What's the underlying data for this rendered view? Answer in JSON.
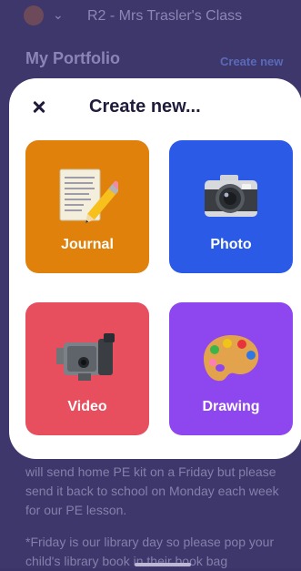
{
  "background": {
    "class_name": "R2 - Mrs Trasler's Class",
    "portfolio_title": "My Portfolio",
    "create_link": "Create new",
    "paragraph_1": "will send home PE kit on a Friday but please send it back to school on Monday each week for our PE lesson.",
    "paragraph_2": "*Friday is our library day so please pop your child's library book in their book bag"
  },
  "modal": {
    "title": "Create new...",
    "options": [
      {
        "label": "Journal",
        "icon": "notepad-pencil-icon",
        "color": "#e0810c"
      },
      {
        "label": "Photo",
        "icon": "camera-icon",
        "color": "#2a5ae6"
      },
      {
        "label": "Video",
        "icon": "video-camera-icon",
        "color": "#e84f5e"
      },
      {
        "label": "Drawing",
        "icon": "paint-palette-icon",
        "color": "#8e46ef"
      }
    ]
  }
}
